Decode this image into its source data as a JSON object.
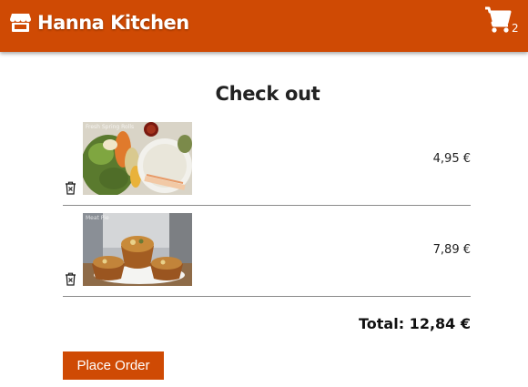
{
  "header": {
    "brand_icon": "storefront-icon",
    "title": "Hanna Kitchen",
    "cart_icon": "shopping-cart-icon",
    "cart_count": "2",
    "color": "#cf4a04"
  },
  "checkout": {
    "title": "Check out",
    "items": [
      {
        "image": "spring-rolls-photo",
        "image_caption": "Fresh Spring Rolls",
        "price": "4,95 €",
        "remove_icon": "trash-icon"
      },
      {
        "image": "meat-pies-photo",
        "image_caption": "Meat Pie",
        "price": "7,89 €",
        "remove_icon": "trash-icon"
      }
    ],
    "total": "Total: 12,84 €",
    "place_order_label": "Place Order"
  }
}
